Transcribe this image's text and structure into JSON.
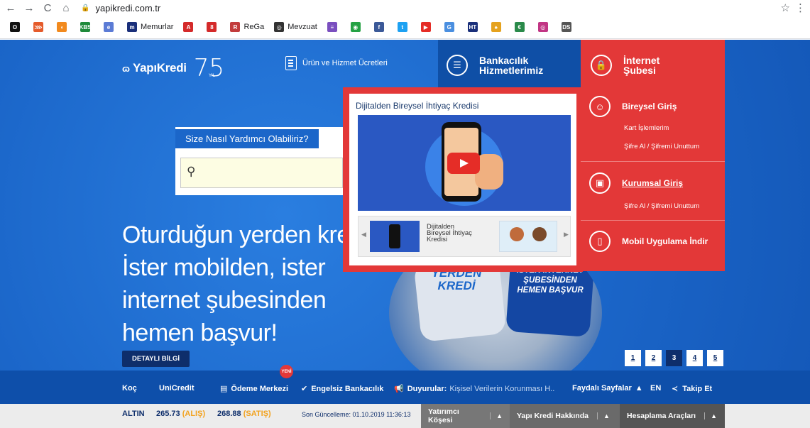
{
  "browser": {
    "back": "←",
    "forward": "→",
    "reload": "C",
    "home": "⌂",
    "url": "yapikredi.com.tr",
    "star": "☆",
    "more": "⋮"
  },
  "bookmarks": [
    {
      "label": "",
      "color": "#111111",
      "glyph": "O"
    },
    {
      "label": "",
      "color": "#e55b2b",
      "glyph": "⋙"
    },
    {
      "label": "",
      "color": "#f28a1e",
      "glyph": "◖"
    },
    {
      "label": "",
      "color": "#1f8a3a",
      "glyph": "KBS"
    },
    {
      "label": "",
      "color": "#5b7bd5",
      "glyph": "e"
    },
    {
      "label": "Memurlar",
      "color": "#1a2f7a",
      "glyph": "m"
    },
    {
      "label": "",
      "color": "#d42a2a",
      "glyph": "A"
    },
    {
      "label": "",
      "color": "#d42a2a",
      "glyph": "8"
    },
    {
      "label": "ReGa",
      "color": "#c23c3c",
      "glyph": "R"
    },
    {
      "label": "Mevzuat",
      "color": "#333333",
      "glyph": "◎"
    },
    {
      "label": "",
      "color": "#7a4fbf",
      "glyph": "≡"
    },
    {
      "label": "",
      "color": "#25a244",
      "glyph": "◉"
    },
    {
      "label": "",
      "color": "#3b5998",
      "glyph": "f"
    },
    {
      "label": "",
      "color": "#1da1f2",
      "glyph": "t"
    },
    {
      "label": "",
      "color": "#e52d27",
      "glyph": "▶"
    },
    {
      "label": "",
      "color": "#4a8fe0",
      "glyph": "G"
    },
    {
      "label": "",
      "color": "#1a2f7a",
      "glyph": "HT"
    },
    {
      "label": "",
      "color": "#e5a21e",
      "glyph": "♠"
    },
    {
      "label": "",
      "color": "#2a8a4a",
      "glyph": "€"
    },
    {
      "label": "",
      "color": "#c13584",
      "glyph": "◎"
    },
    {
      "label": "",
      "color": "#555555",
      "glyph": "DS"
    }
  ],
  "header": {
    "logo_mark": "ɷ",
    "logo_name": "YapıKredi",
    "anniversary": "75",
    "anniversary_sub": "YIL",
    "products_label": "Ürün ve Hizmet Ücretleri",
    "banking_label_1": "Bankacılık",
    "banking_label_2": "Hizmetlerimiz",
    "internet_label_1": "İnternet",
    "internet_label_2": "Şubesi"
  },
  "dropdown": {
    "bireysel_title": "Bireysel Giriş",
    "kart": "Kart İşlemlerim",
    "sifre1": "Şifre Al / Şifremi Unuttum",
    "kurumsal_title": "Kurumsal Giriş",
    "sifre2": "Şifre Al / Şifremi Unuttum",
    "mobil": "Mobil Uygulama İndir"
  },
  "video": {
    "title": "Dijitalden Bireysel İhtiyaç Kredisi",
    "thumb_label_1": "Dijitalden",
    "thumb_label_2": "Bireysel İhtiyaç",
    "thumb_label_3": "Kredisi",
    "prev": "◀",
    "next": "▶"
  },
  "help": {
    "tab": "Size Nasıl Yardımcı Olabiliriz?",
    "icon": "🔍"
  },
  "hero": {
    "line1": "Oturduğun yerden kredi",
    "line2": "İster mobilden, ister",
    "line3": "internet şubesinden",
    "line4": "hemen başvur!",
    "sofa_text_1": "YERDEN",
    "sofa_text_2": "KREDİ",
    "sofa_text_3": "İSTER İNTERNET",
    "sofa_text_4": "ŞUBESİNDEN",
    "sofa_text_5": "HEMEN BAŞVUR",
    "detay": "DETAYLI BİLGİ"
  },
  "pager": [
    "1",
    "2",
    "3",
    "4",
    "5"
  ],
  "pager_active_index": 2,
  "footer": {
    "koc": "Koç",
    "unicredit": "UniCredit",
    "yeni": "YENİ",
    "odeme": "Ödeme Merkezi",
    "engelsiz": "Engelsiz Bankacılık",
    "duyurular": "Duyurular:",
    "duyuru_text": "Kişisel Verilerin Korunması H..",
    "faydali": "Faydalı Sayfalar",
    "en": "EN",
    "takip": "Takip Et"
  },
  "ticker": {
    "altin": "ALTIN",
    "alis_value": "265.73",
    "alis_label": "(ALIŞ)",
    "satis_value": "268.88",
    "satis_label": "(SATIŞ)",
    "update": "Son Güncelleme: 01.10.2019 11:36:13",
    "tab1": "Yatırımcı Köşesi",
    "tab2": "Yapı Kredi Hakkında",
    "tab3": "Hesaplama Araçları",
    "up": "▲"
  },
  "colors": {
    "brand_blue": "#1b66c9",
    "dark_blue": "#0e2e6b",
    "red": "#e33838",
    "orange": "#f2a21e"
  }
}
